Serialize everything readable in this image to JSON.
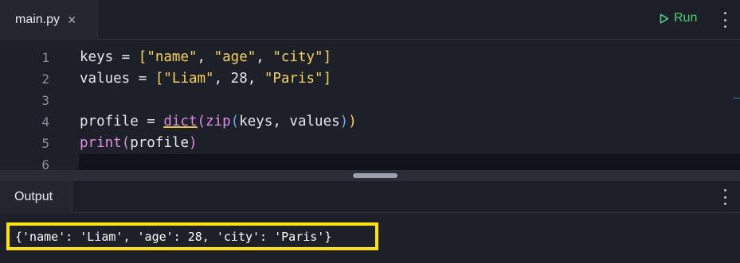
{
  "tab": {
    "filename": "main.py",
    "close_glyph": "×"
  },
  "toolbar": {
    "run_label": "Run",
    "run_icon": "play-icon",
    "menu_icon": "kebab-menu-icon"
  },
  "editor": {
    "line_numbers": [
      "1",
      "2",
      "3",
      "4",
      "5",
      "6"
    ],
    "lines": [
      [
        {
          "t": "keys = ",
          "c": ""
        },
        {
          "t": "[",
          "c": "tok-brk"
        },
        {
          "t": "\"name\"",
          "c": "tok-str"
        },
        {
          "t": ", ",
          "c": ""
        },
        {
          "t": "\"age\"",
          "c": "tok-str"
        },
        {
          "t": ", ",
          "c": ""
        },
        {
          "t": "\"city\"",
          "c": "tok-str"
        },
        {
          "t": "]",
          "c": "tok-brk"
        }
      ],
      [
        {
          "t": "values = ",
          "c": ""
        },
        {
          "t": "[",
          "c": "tok-brk"
        },
        {
          "t": "\"Liam\"",
          "c": "tok-str"
        },
        {
          "t": ", 28, ",
          "c": ""
        },
        {
          "t": "\"Paris\"",
          "c": "tok-str"
        },
        {
          "t": "]",
          "c": "tok-brk"
        }
      ],
      [],
      [
        {
          "t": "profile = ",
          "c": ""
        },
        {
          "t": "dict",
          "c": "tok-fn squiggle"
        },
        {
          "t": "(",
          "c": "tok-paren1"
        },
        {
          "t": "zip",
          "c": "tok-fn2"
        },
        {
          "t": "(",
          "c": "tok-paren2"
        },
        {
          "t": "keys, values",
          "c": ""
        },
        {
          "t": ")",
          "c": "tok-paren2"
        },
        {
          "t": ")",
          "c": "tok-paren3"
        }
      ],
      [
        {
          "t": "print",
          "c": "tok-fn"
        },
        {
          "t": "(",
          "c": "tok-paren1"
        },
        {
          "t": "profile",
          "c": ""
        },
        {
          "t": ")",
          "c": "tok-paren1"
        }
      ],
      []
    ]
  },
  "output": {
    "tab_label": "Output",
    "text": "{'name': 'Liam', 'age': 28, 'city': 'Paris'}",
    "highlight_color": "#ffe600"
  },
  "colors": {
    "run": "#4bd17f",
    "string": "#f3d35a",
    "function": "#d98fe0",
    "background": "#1e2029"
  }
}
